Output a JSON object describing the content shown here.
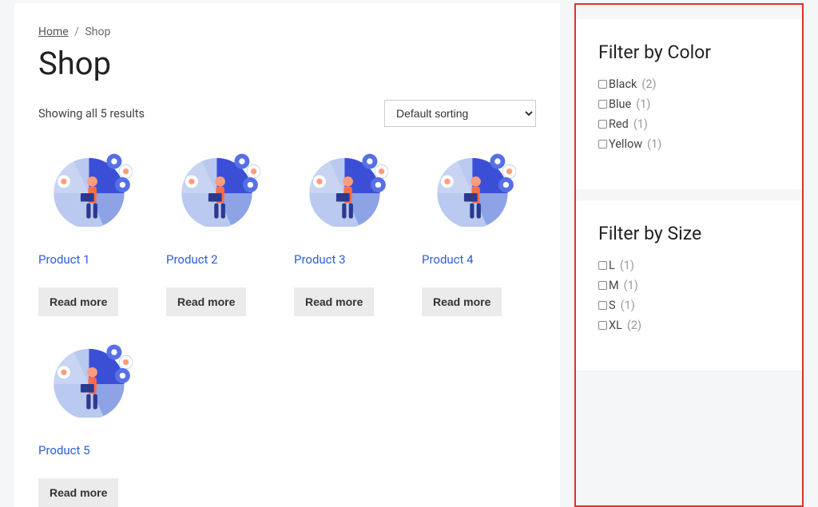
{
  "breadcrumb": {
    "home_label": "Home",
    "separator": "/",
    "current": "Shop"
  },
  "page_title": "Shop",
  "result_count": "Showing all 5 results",
  "sort": {
    "selected": "Default sorting"
  },
  "products": [
    {
      "title": "Product 1",
      "button": "Read more"
    },
    {
      "title": "Product 2",
      "button": "Read more"
    },
    {
      "title": "Product 3",
      "button": "Read more"
    },
    {
      "title": "Product 4",
      "button": "Read more"
    },
    {
      "title": "Product 5",
      "button": "Read more"
    }
  ],
  "sidebar": {
    "color": {
      "title": "Filter by Color",
      "items": [
        {
          "label": "Black",
          "count": "(2)"
        },
        {
          "label": "Blue",
          "count": "(1)"
        },
        {
          "label": "Red",
          "count": "(1)"
        },
        {
          "label": "Yellow",
          "count": "(1)"
        }
      ]
    },
    "size": {
      "title": "Filter by Size",
      "items": [
        {
          "label": "L",
          "count": "(1)"
        },
        {
          "label": "M",
          "count": "(1)"
        },
        {
          "label": "S",
          "count": "(1)"
        },
        {
          "label": "XL",
          "count": "(2)"
        }
      ]
    }
  }
}
